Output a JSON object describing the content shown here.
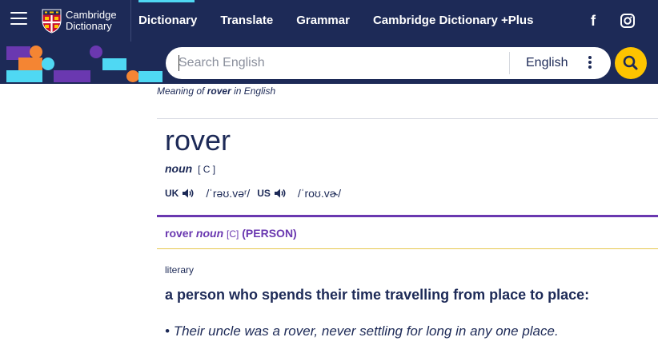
{
  "colors": {
    "navy": "#1d2a57",
    "purple": "#6a38b0",
    "yellow": "#fec400",
    "cyan": "#4fd8f3",
    "orange": "#f48533"
  },
  "header": {
    "logo_line1": "Cambridge",
    "logo_line2": "Dictionary",
    "nav": [
      {
        "label": "Dictionary",
        "active": true
      },
      {
        "label": "Translate"
      },
      {
        "label": "Grammar"
      },
      {
        "label": "Cambridge Dictionary +Plus"
      }
    ],
    "icons": [
      "menu-icon",
      "cambridge-shield-logo",
      "facebook-icon",
      "instagram-icon"
    ]
  },
  "search": {
    "placeholder": "Search English",
    "language": "English",
    "icons": [
      "more-options-icon",
      "search-icon"
    ]
  },
  "entry": {
    "breadcrumb_prefix": "Meaning of ",
    "breadcrumb_word": "rover",
    "breadcrumb_suffix": " in English",
    "headword": "rover",
    "pos": "noun",
    "grammar": "[ C ]",
    "uk_label": "UK",
    "uk_ipa": "/ˈrəʊ.vəʳ/",
    "us_label": "US",
    "us_ipa": "/ˈroʊ.vɚ/",
    "sense_word": "rover",
    "sense_pos": "noun",
    "sense_grammar": "[C]",
    "sense_guide": "(PERSON)",
    "register": "literary",
    "definition": "a person who spends their time travelling from place to place:",
    "example_bullet": "•",
    "example": "Their uncle was a rover, never settling for long in any one place."
  }
}
